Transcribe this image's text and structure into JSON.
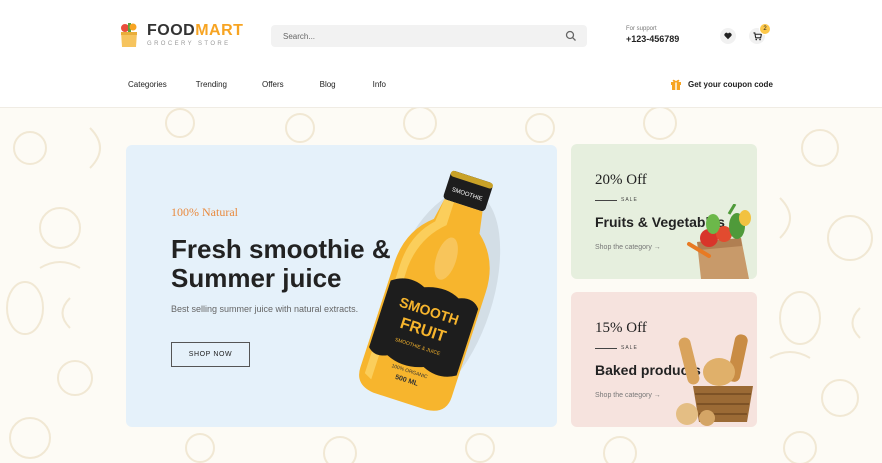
{
  "header": {
    "brand": {
      "main_a": "FOOD",
      "main_b": "MART",
      "sub": "GROCERY STORE"
    },
    "search": {
      "placeholder": "Search..."
    },
    "support": {
      "label": "For support",
      "phone": "+123-456789"
    },
    "cart_count": "2"
  },
  "nav": {
    "items": [
      "Categories",
      "Trending",
      "Offers",
      "Blog",
      "Info"
    ],
    "coupon": "Get your coupon code"
  },
  "hero": {
    "kicker": "100% Natural",
    "title": "Fresh smoothie & Summer juice",
    "desc": "Best selling summer juice with natural extracts.",
    "cta": "SHOP NOW",
    "bottle": {
      "brand1": "SMOOTH",
      "brand2": "FRUIT",
      "small": "SMOOTHIE & JUICE",
      "organic": "100% ORGANIC",
      "volume": "500 ML",
      "cap": "SMOOTHIE"
    }
  },
  "promos": [
    {
      "off": "20% Off",
      "sale": "SALE",
      "title": "Fruits & Vegetables",
      "link": "Shop the category →"
    },
    {
      "off": "15% Off",
      "sale": "SALE",
      "title": "Baked products",
      "link": "Shop the category →"
    }
  ],
  "colors": {
    "accent": "#f7a422",
    "hero_bg": "#e5f1fa",
    "promo1_bg": "#e6efde",
    "promo2_bg": "#f6e3de",
    "badge": "#fdc84a"
  }
}
